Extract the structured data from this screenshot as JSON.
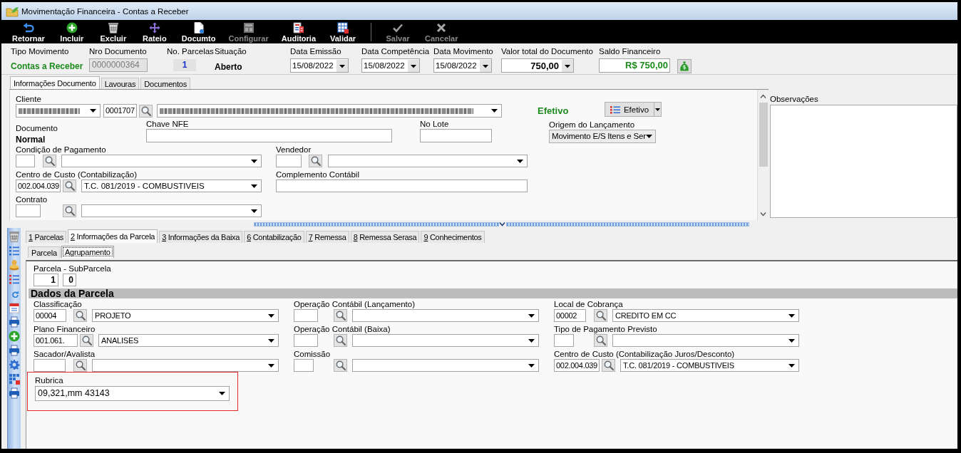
{
  "window": {
    "title": "Movimentação Financeira - Contas a Receber"
  },
  "toolbar": {
    "groups": [
      [
        {
          "label": "Retornar",
          "disabled": false
        },
        {
          "label": "Incluir",
          "disabled": false
        },
        {
          "label": "Excluir",
          "disabled": false
        },
        {
          "label": "Rateio",
          "disabled": false
        },
        {
          "label": "Documto",
          "disabled": false
        },
        {
          "label": "Configurar",
          "disabled": true
        },
        {
          "label": "Auditoria",
          "disabled": false
        },
        {
          "label": "Validar",
          "disabled": false
        }
      ],
      [
        {
          "label": "Salvar",
          "disabled": true
        },
        {
          "label": "Cancelar",
          "disabled": true
        }
      ]
    ]
  },
  "header": {
    "fields": [
      {
        "kind": "movement",
        "label": "Tipo Movimento",
        "value": "Contas a Receber"
      },
      {
        "kind": "field",
        "label": "Nro Documento",
        "value": "0000000364",
        "disabled": true
      },
      {
        "kind": "counter",
        "label": "No. Parcelas",
        "value": "1"
      },
      {
        "kind": "status",
        "label": "Situação",
        "value": "Aberto"
      },
      {
        "kind": "date",
        "label": "Data Emissão",
        "value": "15/08/2022"
      },
      {
        "kind": "date",
        "label": "Data Competência",
        "value": "15/08/2022"
      },
      {
        "kind": "date",
        "label": "Data Movimento",
        "value": "15/08/2022"
      },
      {
        "kind": "amount",
        "label": "Valor total do Documento",
        "value": "750,00"
      },
      {
        "kind": "balance",
        "label": "Saldo Financeiro",
        "value": "R$ 750,00"
      }
    ]
  },
  "document_tabs": [
    {
      "label": "Informações Documento",
      "selected": true
    },
    {
      "label": "Lavouras",
      "selected": false
    },
    {
      "label": "Documentos",
      "selected": false
    }
  ],
  "document_form": {
    "cliente": {
      "label": "Cliente",
      "document_number": {
        "redacted": true
      },
      "code": "0001707",
      "name": {
        "redacted": true
      }
    },
    "efetivo": {
      "status_text": "Efetivo",
      "status_button": "Efetivo"
    },
    "documento": {
      "label": "Documento",
      "value": "Normal"
    },
    "chave_nfe": {
      "label": "Chave NFE"
    },
    "no_lote": {
      "label": "No Lote"
    },
    "origem_lancamento": {
      "label": "Origem do Lançamento",
      "value": "Movimento E/S Itens e Ser"
    },
    "condicao_pagamento": {
      "label": "Condição de Pagamento"
    },
    "vendedor": {
      "label": "Vendedor"
    },
    "centro_custo": {
      "label": "Centro de Custo (Contabilização)",
      "code": "002.004.039",
      "description": "T.C. 081/2019 - COMBUSTIVEIS"
    },
    "complemento_contabil": {
      "label": "Complemento Contábil"
    },
    "contrato": {
      "label": "Contrato"
    }
  },
  "observacoes": {
    "label": "Observações"
  },
  "parcela_tabs": [
    {
      "key": "1",
      "label": "Parcelas",
      "selected": false
    },
    {
      "key": "2",
      "label": "Informações da Parcela",
      "selected": true
    },
    {
      "key": "3",
      "label": "Informações da Baixa",
      "selected": false
    },
    {
      "key": "6",
      "label": "Contabilização",
      "selected": false
    },
    {
      "key": "7",
      "label": "Remessa",
      "selected": false
    },
    {
      "key": "8",
      "label": "Remessa Serasa",
      "selected": false
    },
    {
      "key": "9",
      "label": "Conhecimentos",
      "selected": false
    }
  ],
  "sub_tabs": [
    {
      "label": "Parcela",
      "selected": false
    },
    {
      "label": "Agrupamento",
      "selected": true
    }
  ],
  "parcela_form": {
    "parcela_subparcela": {
      "label": "Parcela - SubParcela",
      "parcela": "1",
      "subparcela": "0"
    },
    "section_title": "Dados da Parcela",
    "rows": [
      [
        {
          "label": "Classificação",
          "code": "00004",
          "description": "PROJETO"
        },
        {
          "label": "Operação Contábil (Lançamento)"
        },
        {
          "label": "Local de Cobrança",
          "code": "00002",
          "description": "CREDITO EM CC"
        }
      ],
      [
        {
          "label": "Plano Financeiro",
          "code": "001.061.",
          "description": "ANALISES"
        },
        {
          "label": "Operação Contábil (Baixa)"
        },
        {
          "label": "Tipo de Pagamento Previsto"
        }
      ],
      [
        {
          "label": "Sacador/Avalista"
        },
        {
          "label": "Comissão"
        },
        {
          "label": "Centro de Custo (Contabilização Juros/Desconto)",
          "code": "002.004.039",
          "description": "T.C. 081/2019 - COMBUSTIVEIS"
        }
      ]
    ],
    "rubrica": {
      "label": "Rubrica",
      "value": "09,321,mm 43143",
      "highlighted": true
    }
  }
}
